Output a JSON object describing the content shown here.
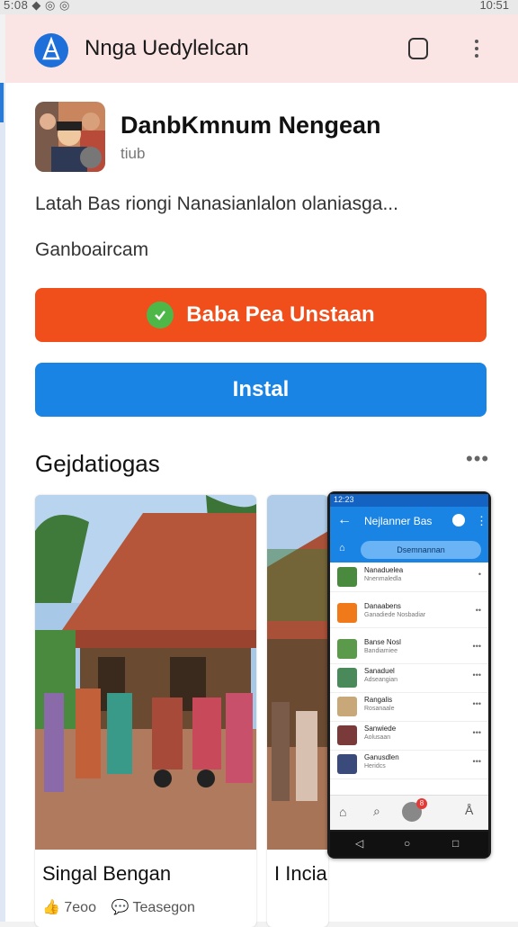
{
  "status_bar": {
    "left": "5:08 ◆ ◎ ◎",
    "right": "10:51"
  },
  "app_bar": {
    "title": "Nnga Uedylelcan"
  },
  "app": {
    "publisher_name": "DanbKmnum Nengean",
    "publisher_sub": "tiub",
    "description": "Latah Bas riongi  Nanasianlalon olaniasga...",
    "category": "Ganboaircam",
    "primary_button": "Baba Pea Unstaan",
    "install_button": "Instal"
  },
  "section": {
    "title": "Gejdatiogas",
    "more": "•••",
    "cards": [
      {
        "title": "Singal Bengan",
        "meta_1": "7eoo",
        "meta_2": "Teasegon"
      },
      {
        "title": "I Incia"
      }
    ]
  },
  "phone": {
    "status_time": "12:23",
    "title": "Nejlanner Bas",
    "pill": "Dsemnannan",
    "rows": [
      {
        "title": "Nanaduelea",
        "sub": "Nnenmaledla"
      },
      {
        "title": "Danaabens",
        "sub": "Ganadiede Nosbadiar"
      },
      {
        "title": "Banse Nosl",
        "sub": "Bandiamiee"
      },
      {
        "title": "Sanaduel",
        "sub": "Adseangian"
      },
      {
        "title": "Rangalis",
        "sub": "Rosanaale"
      },
      {
        "title": "Sanwiede",
        "sub": "Aolusaan"
      },
      {
        "title": "Ganusdlen",
        "sub": "Heridcs"
      }
    ],
    "badge": "8"
  },
  "colors": {
    "accent_orange": "#f04e1a",
    "accent_blue": "#1a84e5",
    "appbar_bg": "#fbe4e4"
  }
}
